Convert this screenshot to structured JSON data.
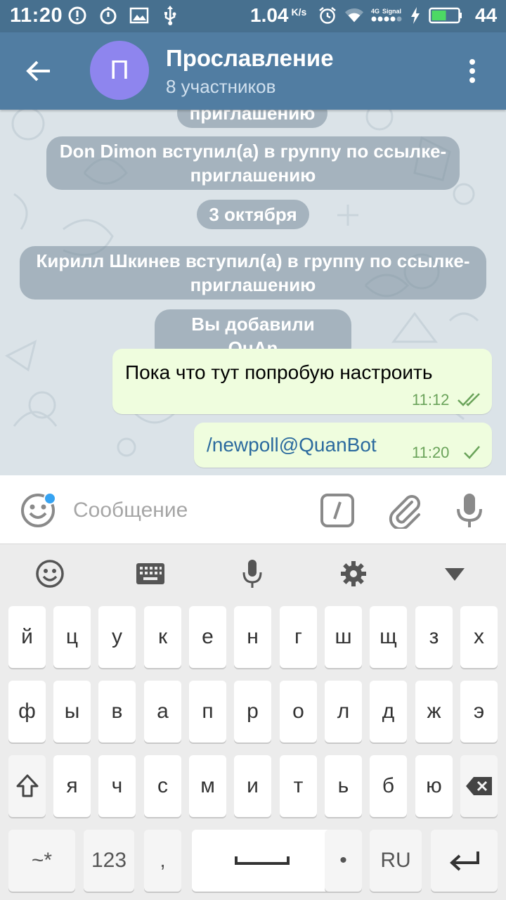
{
  "status_bar": {
    "time": "11:20",
    "speed": "1.04",
    "speed_unit": "K/s",
    "network": "4G",
    "signal_label": "Signal",
    "battery": "44"
  },
  "header": {
    "avatar_letter": "П",
    "title": "Прославление",
    "subtitle": "8 участников"
  },
  "chat": {
    "partial_system": "приглашению",
    "system_1_line1": "Don Dimon вступил(а) в группу по ссылке-",
    "system_1_line2": "приглашению",
    "date": "3 октября",
    "system_2_line1": "Кирилл Шкинев вступил(а) в группу по ссылке-",
    "system_2_line2": "приглашению",
    "system_3": "Вы добавили QuAn",
    "messages": [
      {
        "text": "Пока что тут попробую настроить",
        "time": "11:12",
        "status": "read"
      },
      {
        "text": "/newpoll@QuanBot",
        "time": "11:20",
        "status": "sent"
      }
    ]
  },
  "input": {
    "placeholder": "Сообщение"
  },
  "keyboard": {
    "row1": [
      "й",
      "ц",
      "у",
      "к",
      "е",
      "н",
      "г",
      "ш",
      "щ",
      "з",
      "х"
    ],
    "row2": [
      "ф",
      "ы",
      "в",
      "а",
      "п",
      "р",
      "о",
      "л",
      "д",
      "ж",
      "э"
    ],
    "row3": [
      "я",
      "ч",
      "с",
      "м",
      "и",
      "т",
      "ь",
      "б",
      "ю"
    ],
    "row4": {
      "symbols": "~*",
      "numbers": "123",
      "comma": ",",
      "period": "•",
      "lang": "RU"
    }
  },
  "colors": {
    "header": "#517da2",
    "status_bar": "#47708f",
    "outgoing_bubble": "#effdde",
    "check": "#6aa35a",
    "avatar": "#8e85ee"
  }
}
